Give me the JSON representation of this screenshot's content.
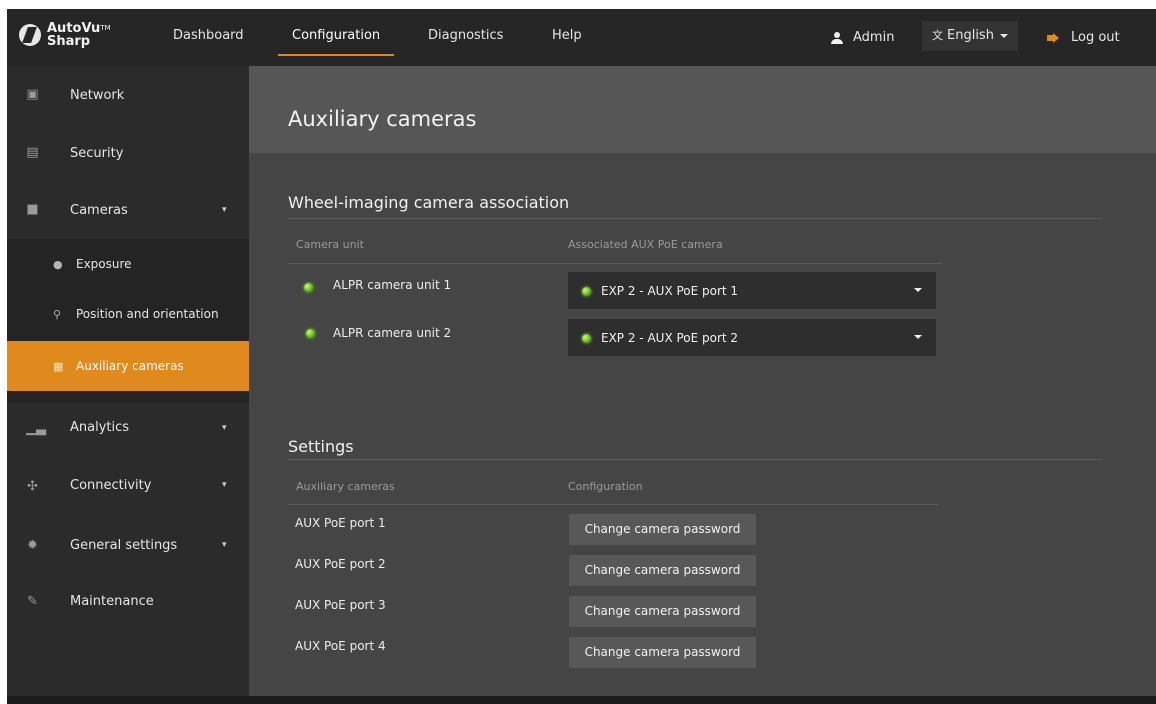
{
  "brand": {
    "line1": "AutoVu",
    "line2": "Sharp",
    "mark": "TM"
  },
  "topnav": {
    "dashboard": "Dashboard",
    "configuration": "Configuration",
    "diagnostics": "Diagnostics",
    "help": "Help"
  },
  "user": {
    "name": "Admin",
    "icon": "user-icon"
  },
  "language": {
    "selected": "English",
    "icon": "language-icon"
  },
  "logout": {
    "label": "Log out",
    "icon": "logout-icon"
  },
  "sidebar": {
    "items": [
      {
        "label": "Network",
        "icon": "network-icon"
      },
      {
        "label": "Security",
        "icon": "security-icon"
      },
      {
        "label": "Cameras",
        "icon": "camera-icon",
        "expanded": true
      },
      {
        "label": "Analytics",
        "icon": "analytics-icon"
      },
      {
        "label": "Connectivity",
        "icon": "connectivity-icon"
      },
      {
        "label": "General settings",
        "icon": "gear-icon"
      },
      {
        "label": "Maintenance",
        "icon": "wrench-icon"
      }
    ],
    "sub_items": [
      {
        "label": "Exposure",
        "icon": "exposure-icon"
      },
      {
        "label": "Position and orientation",
        "icon": "pin-icon"
      },
      {
        "label": "Auxiliary cameras",
        "icon": "aux-camera-icon",
        "active": true
      }
    ]
  },
  "page": {
    "title": "Auxiliary cameras"
  },
  "association": {
    "title": "Wheel-imaging camera association",
    "col_unit": "Camera unit",
    "col_camera": "Associated AUX PoE camera",
    "rows": [
      {
        "unit": "ALPR camera unit 1",
        "camera": "EXP 2 - AUX PoE port 1",
        "status": "online"
      },
      {
        "unit": "ALPR camera unit 2",
        "camera": "EXP 2 - AUX PoE port 2",
        "status": "online"
      }
    ]
  },
  "settings": {
    "title": "Settings",
    "col_aux": "Auxiliary cameras",
    "col_config": "Configuration",
    "rows": [
      {
        "port": "AUX PoE port 1",
        "action": "Change camera password"
      },
      {
        "port": "AUX PoE port 2",
        "action": "Change camera password"
      },
      {
        "port": "AUX PoE port 3",
        "action": "Change camera password"
      },
      {
        "port": "AUX PoE port 4",
        "action": "Change camera password"
      }
    ]
  },
  "colors": {
    "accent": "#e08a1e",
    "status_online": "#5cc218",
    "topbar": "#262626",
    "sidebar": "#2b2b2b",
    "content": "#454545"
  }
}
